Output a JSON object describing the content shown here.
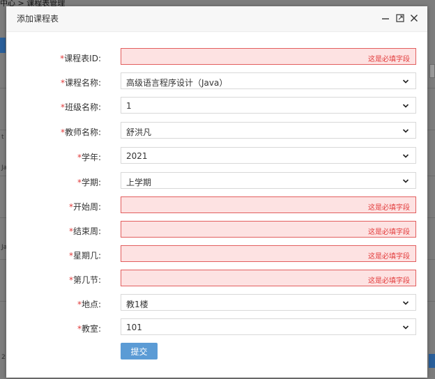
{
  "background": {
    "breadcrumb": "中心  >  课程表管理",
    "left_letters": [
      "t",
      "Ja",
      "Ja",
      "2"
    ],
    "pager_number": "2"
  },
  "dialog": {
    "title": "添加课程表",
    "required_mark": "*",
    "error_text": "这是必填字段",
    "submit_label": "提交",
    "fields": [
      {
        "label": "课程表ID:",
        "type": "input",
        "value": "",
        "error": true
      },
      {
        "label": "课程名称:",
        "type": "select",
        "value": "高级语言程序设计（Java）",
        "error": false
      },
      {
        "label": "班级名称:",
        "type": "select",
        "value": "1",
        "error": false
      },
      {
        "label": "教师名称:",
        "type": "select",
        "value": "舒洪凡",
        "error": false
      },
      {
        "label": "学年:",
        "type": "select",
        "value": "2021",
        "error": false
      },
      {
        "label": "学期:",
        "type": "select",
        "value": "上学期",
        "error": false
      },
      {
        "label": "开始周:",
        "type": "input",
        "value": "",
        "error": true
      },
      {
        "label": "结束周:",
        "type": "input",
        "value": "",
        "error": true
      },
      {
        "label": "星期几:",
        "type": "input",
        "value": "",
        "error": true
      },
      {
        "label": "第几节:",
        "type": "input",
        "value": "",
        "error": true
      },
      {
        "label": "地点:",
        "type": "select",
        "value": "教1楼",
        "error": false
      },
      {
        "label": "教室:",
        "type": "select",
        "value": "101",
        "error": false
      }
    ]
  },
  "colors": {
    "error_bg": "#fde2e2",
    "error_border": "#e25e5e",
    "error_text": "#e23b3b",
    "required": "#e03b3b",
    "submit_bg": "#5b9bd5",
    "overlay": "#7d7d7d"
  }
}
